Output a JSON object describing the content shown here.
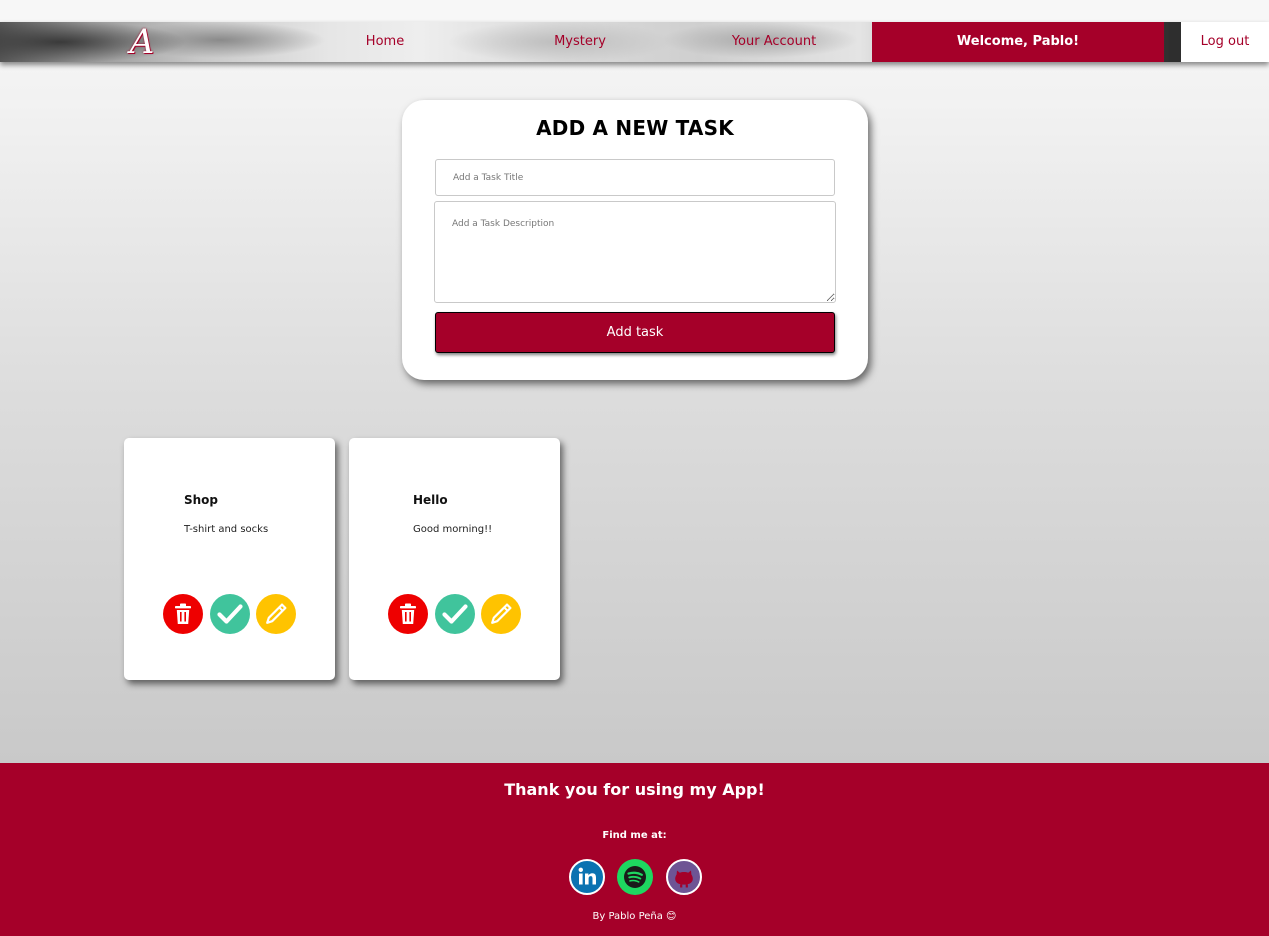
{
  "nav": {
    "logo_letter": "A",
    "links": [
      "Home",
      "Mystery",
      "Your Account"
    ],
    "welcome": "Welcome, Pablo!",
    "logout": "Log out"
  },
  "form": {
    "title": "ADD A NEW TASK",
    "title_placeholder": "Add a Task Title",
    "desc_placeholder": "Add a Task Description",
    "button": "Add task"
  },
  "tasks": [
    {
      "title": "Shop",
      "description": "T-shirt and socks"
    },
    {
      "title": "Hello",
      "description": "Good morning!!"
    }
  ],
  "task_actions": [
    "trash-icon",
    "check-icon",
    "pencil-icon"
  ],
  "footer": {
    "thanks": "Thank you for using my App!",
    "find": "Find me at:",
    "socials": [
      "linkedin-icon",
      "spotify-icon",
      "github-icon"
    ],
    "byline": "By Pablo Peña 😊"
  },
  "colors": {
    "brand": "#a50029",
    "delete": "#ee0000",
    "complete": "#40c49c",
    "edit": "#ffc300"
  }
}
